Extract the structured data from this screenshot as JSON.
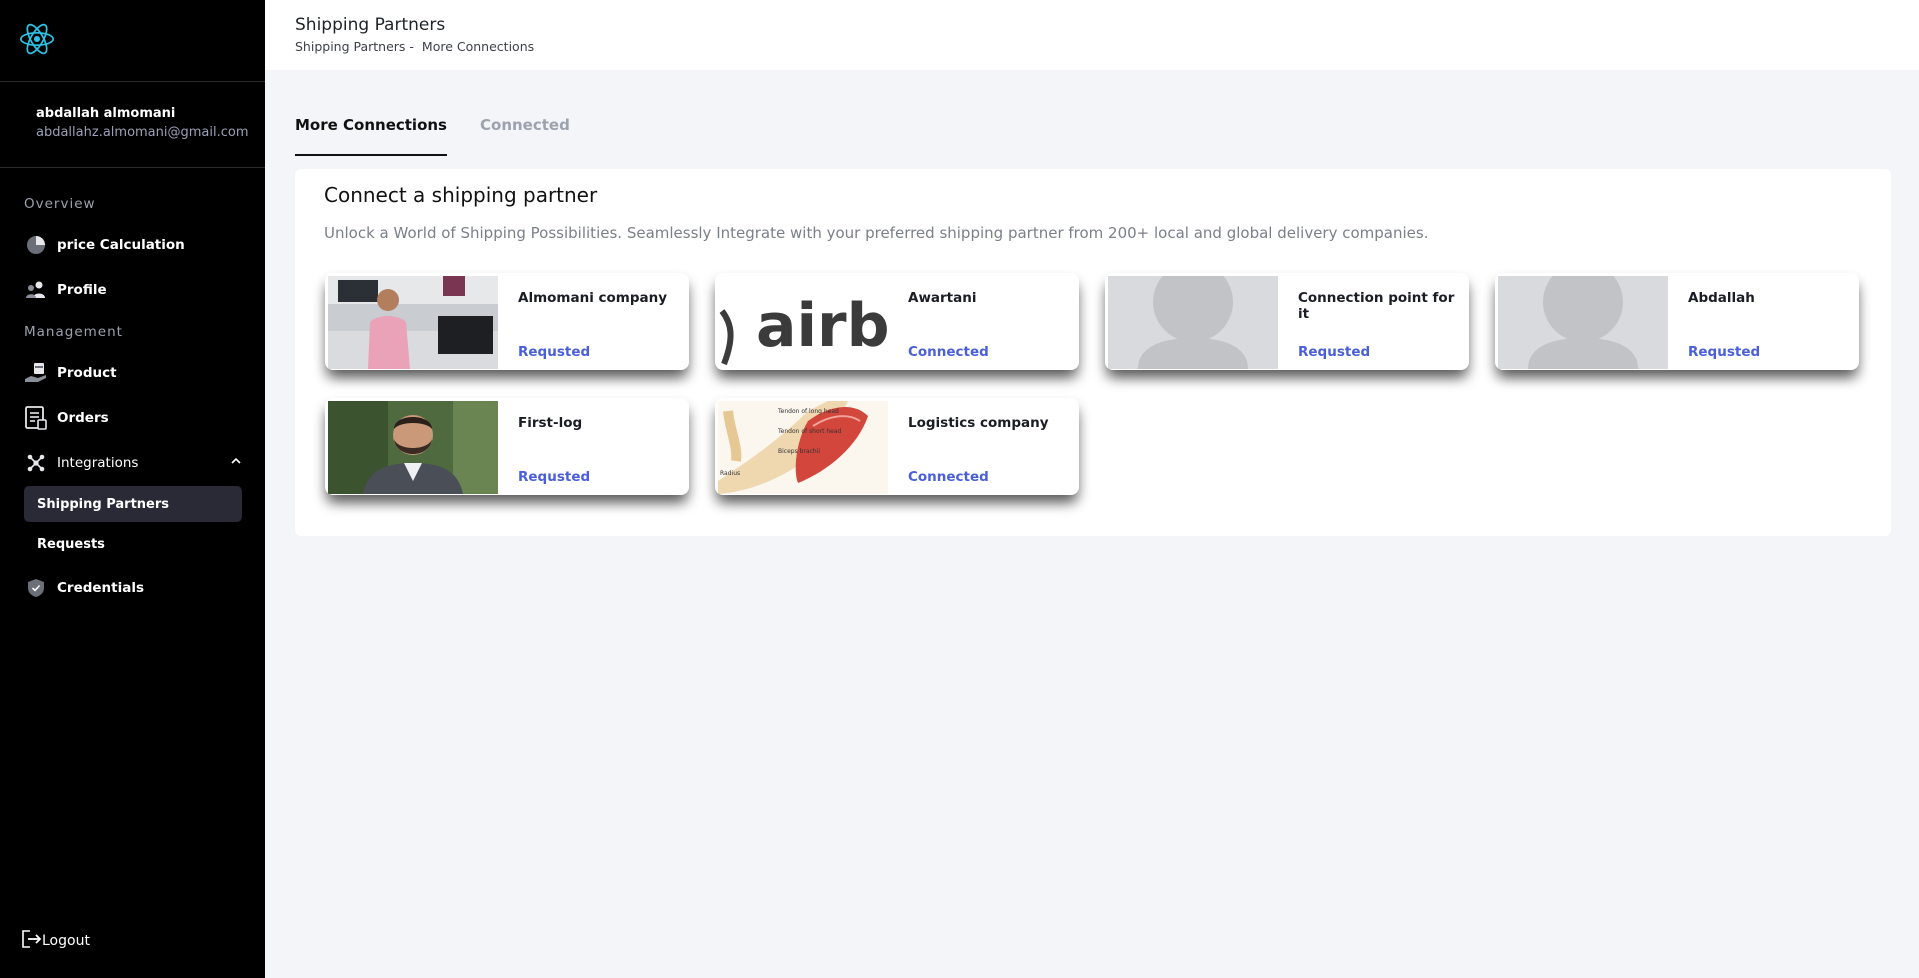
{
  "sidebar": {
    "user_name": "abdallah almomani",
    "user_email": "abdallahz.almomani@gmail.com",
    "overview_title": "Overview",
    "management_title": "Management",
    "items": {
      "price_calculation": "price Calculation",
      "profile": "Profile",
      "product": "Product",
      "orders": "Orders",
      "integrations": "Integrations",
      "shipping_partners": "Shipping Partners",
      "requests": "Requests",
      "credentials": "Credentials"
    },
    "logout": "Logout"
  },
  "header": {
    "title": "Shipping Partners",
    "breadcrumb_1": "Shipping Partners -",
    "breadcrumb_2": "More Connections"
  },
  "tabs": {
    "more_connections": "More Connections",
    "connected": "Connected"
  },
  "panel": {
    "title": "Connect a shipping partner",
    "description": "Unlock a World of Shipping Possibilities. Seamlessly Integrate with your preferred shipping partner from 200+ local and global delivery companies."
  },
  "partners": [
    {
      "name": "Almomani company",
      "status": "Requsted"
    },
    {
      "name": "Awartani",
      "status": "Connected"
    },
    {
      "name": "Connection point for it",
      "status": "Requsted"
    },
    {
      "name": "Abdallah",
      "status": "Requsted"
    },
    {
      "name": "First-log",
      "status": "Requsted"
    },
    {
      "name": "Logistics company",
      "status": "Connected"
    }
  ],
  "logo_text": "airb",
  "anatomy_labels": [
    "Tendon of long head",
    "Tendon of short head",
    "Biceps brachii",
    "Radius"
  ],
  "colors": {
    "sidebar_bg": "#000000",
    "active_item_bg": "#2a2a36",
    "status_link": "#4a5fd8",
    "page_bg": "#f3f5f8"
  }
}
